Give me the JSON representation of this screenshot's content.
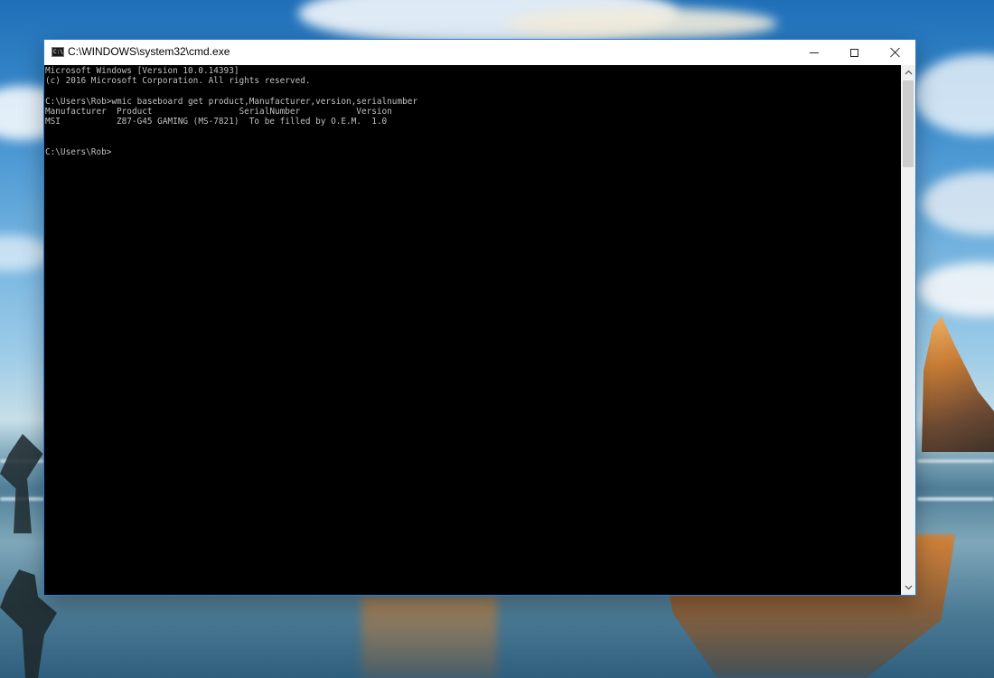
{
  "window": {
    "title": "C:\\WINDOWS\\system32\\cmd.exe",
    "icon": "cmd-icon",
    "icon_text": "C:\\",
    "controls": [
      "minimize-icon",
      "maximize-icon",
      "close-icon"
    ]
  },
  "console": {
    "lines": [
      "Microsoft Windows [Version 10.0.14393]",
      "(c) 2016 Microsoft Corporation. All rights reserved.",
      "",
      "C:\\Users\\Rob>wmic baseboard get product,Manufacturer,version,serialnumber",
      "Manufacturer  Product                 SerialNumber           Version",
      "MSI           Z87-G45 GAMING (MS-7821)  To be filled by O.E.M.  1.0",
      "",
      "",
      "C:\\Users\\Rob>"
    ],
    "text_color": "#c0c0c0",
    "background_color": "#000000"
  },
  "scrollbar": {
    "up_icon": "chevron-up-icon",
    "down_icon": "chevron-down-icon"
  }
}
